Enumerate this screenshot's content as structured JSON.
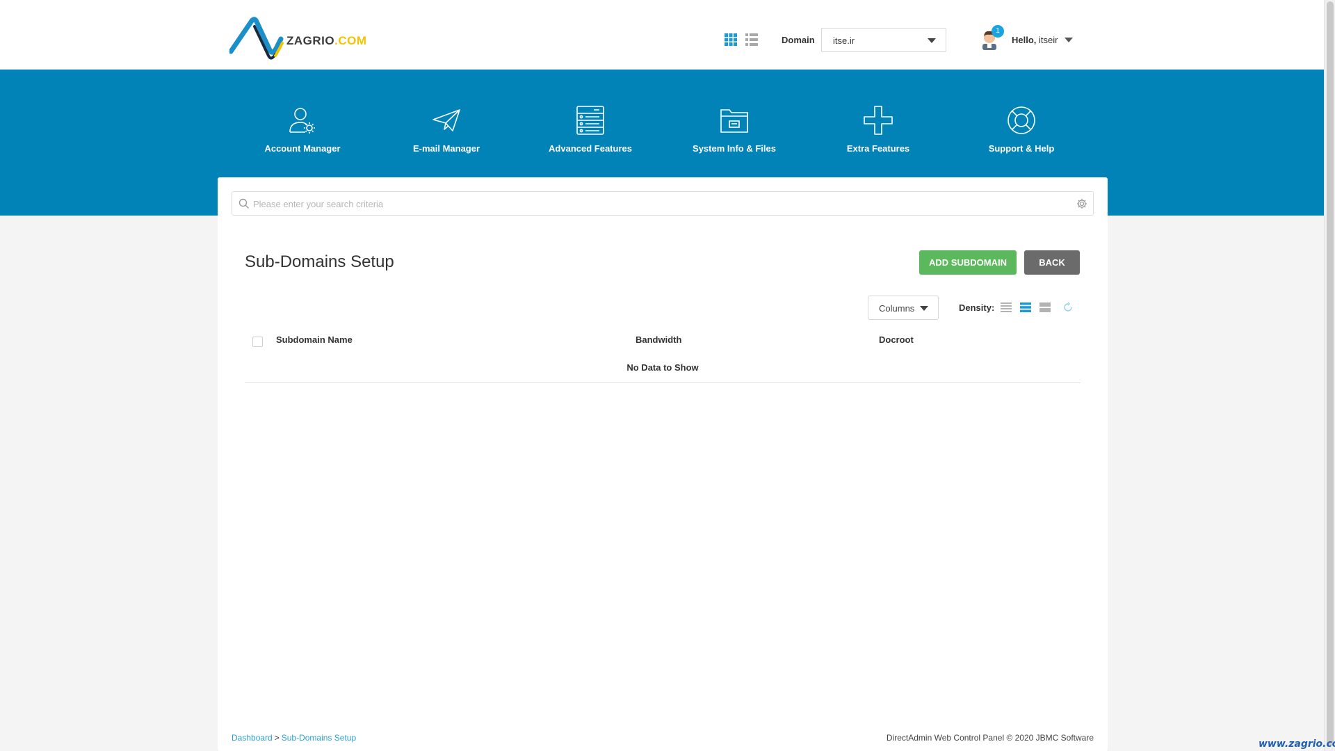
{
  "brand": {
    "name": "ZAGRIO",
    "suffix": ".COM",
    "colors": {
      "primary": "#0183b8",
      "accent": "#f5c400",
      "success": "#5cb85c",
      "link": "#2a9fd6"
    }
  },
  "header": {
    "domain_label": "Domain",
    "domain_value": "itse.ir",
    "notification_count": "1",
    "greeting": "Hello,",
    "username": "itseir"
  },
  "nav": {
    "items": [
      {
        "label": "Account Manager",
        "icon": "account-manager-icon"
      },
      {
        "label": "E-mail Manager",
        "icon": "paper-plane-icon"
      },
      {
        "label": "Advanced Features",
        "icon": "server-icon"
      },
      {
        "label": "System Info & Files",
        "icon": "folder-icon"
      },
      {
        "label": "Extra Features",
        "icon": "plus-icon"
      },
      {
        "label": "Support & Help",
        "icon": "lifebuoy-icon"
      }
    ]
  },
  "search": {
    "placeholder": "Please enter your search criteria",
    "value": ""
  },
  "page": {
    "title": "Sub-Domains Setup",
    "add_button": "ADD SUBDOMAIN",
    "back_button": "BACK"
  },
  "table": {
    "columns_label": "Columns",
    "density_label": "Density:",
    "density_active": "normal",
    "headers": [
      "Subdomain Name",
      "Bandwidth",
      "Docroot"
    ],
    "empty_text": "No Data to Show"
  },
  "footer": {
    "breadcrumb": [
      "Dashboard",
      "Sub-Domains Setup"
    ],
    "breadcrumb_sep": ">",
    "copyright": "DirectAdmin Web Control Panel © 2020 JBMC Software"
  },
  "watermark": "www.zagrio.com"
}
